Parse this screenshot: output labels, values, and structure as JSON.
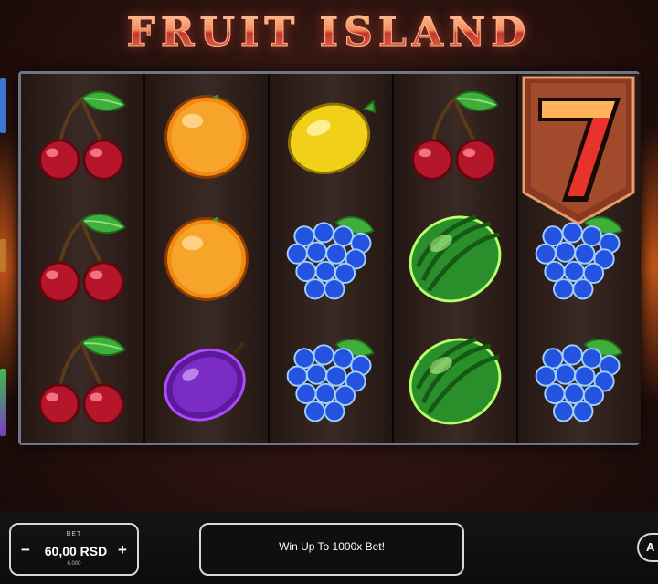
{
  "game": {
    "title": "FRUIT ISLAND"
  },
  "reels": [
    [
      "cherry",
      "cherry",
      "cherry"
    ],
    [
      "orange",
      "orange",
      "plum"
    ],
    [
      "lemon",
      "grapes",
      "grapes"
    ],
    [
      "cherry",
      "watermelon",
      "watermelon"
    ],
    [
      "seven",
      "grapes",
      "grapes"
    ]
  ],
  "controls": {
    "bet_label": "BET",
    "bet_value": "60,00 RSD",
    "bet_sub": "6.000",
    "minus": "−",
    "plus": "+",
    "message": "Win Up To 1000x Bet!",
    "round_button_glyph": "A"
  },
  "colors": {
    "title_gradient_top": "#ffd0a8",
    "title_gradient_bottom": "#c2352c",
    "reel_background": "#3a2a25",
    "frame_border": "#6e7585",
    "control_border": "#d8d8d8"
  },
  "icons": [
    "cherry-icon",
    "orange-icon",
    "lemon-icon",
    "plum-icon",
    "grapes-icon",
    "watermelon-icon",
    "seven-icon"
  ]
}
